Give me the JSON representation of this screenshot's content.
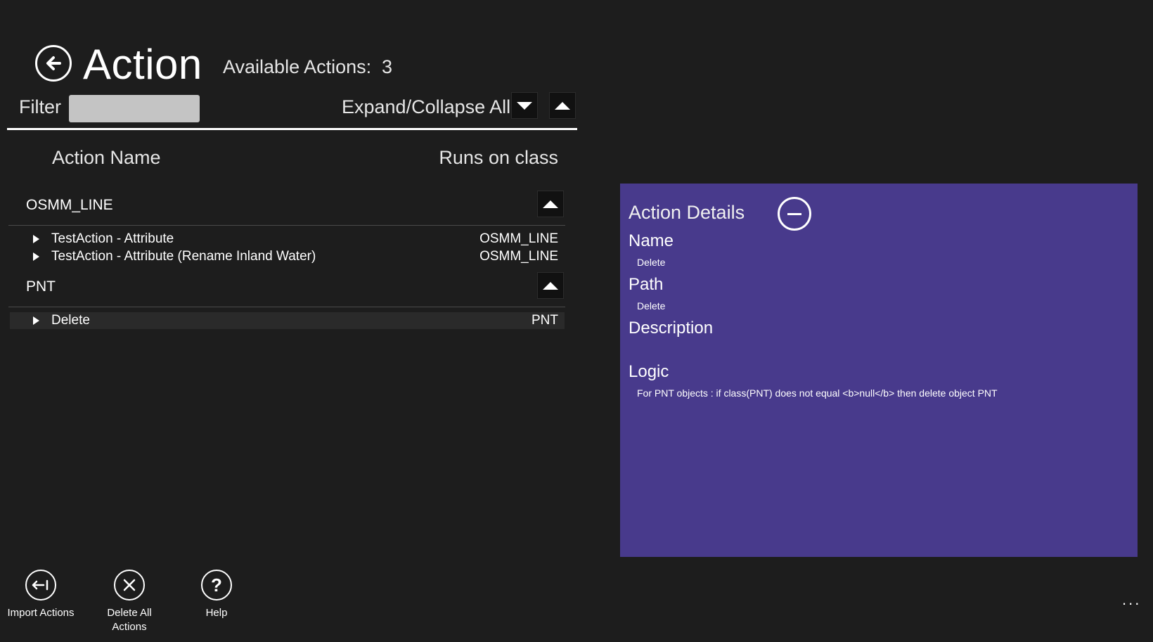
{
  "header": {
    "title": "Action",
    "available_label": "Available Actions:",
    "available_count": "3"
  },
  "filter": {
    "label": "Filter",
    "value": "",
    "placeholder": ""
  },
  "expand_collapse": {
    "label": "Expand/Collapse All"
  },
  "columns": {
    "name": "Action Name",
    "class": "Runs on class"
  },
  "groups": [
    {
      "title": "OSMM_LINE",
      "rows": [
        {
          "name": "TestAction - Attribute",
          "cls": "OSMM_LINE"
        },
        {
          "name": "TestAction - Attribute (Rename Inland Water)",
          "cls": "OSMM_LINE"
        }
      ]
    },
    {
      "title": "PNT",
      "rows": [
        {
          "name": "Delete",
          "cls": "PNT"
        }
      ]
    }
  ],
  "details": {
    "title": "Action Details",
    "name_label": "Name",
    "name_value": "Delete",
    "path_label": "Path",
    "path_value": "Delete",
    "description_label": "Description",
    "description_value": "",
    "logic_label": "Logic",
    "logic_value": "For  PNT objects : if class(PNT) does not equal <b>null</b> then delete object PNT",
    "panel_color": "#483a8c"
  },
  "appbar": {
    "import_label": "Import Actions",
    "delete_all_label_line1": "Delete All",
    "delete_all_label_line2": "Actions",
    "help_label": "Help",
    "more": "..."
  },
  "icons": {
    "back": "back-arrow-icon",
    "import": "import-icon",
    "delete_all": "delete-all-icon",
    "help": "help-icon"
  }
}
